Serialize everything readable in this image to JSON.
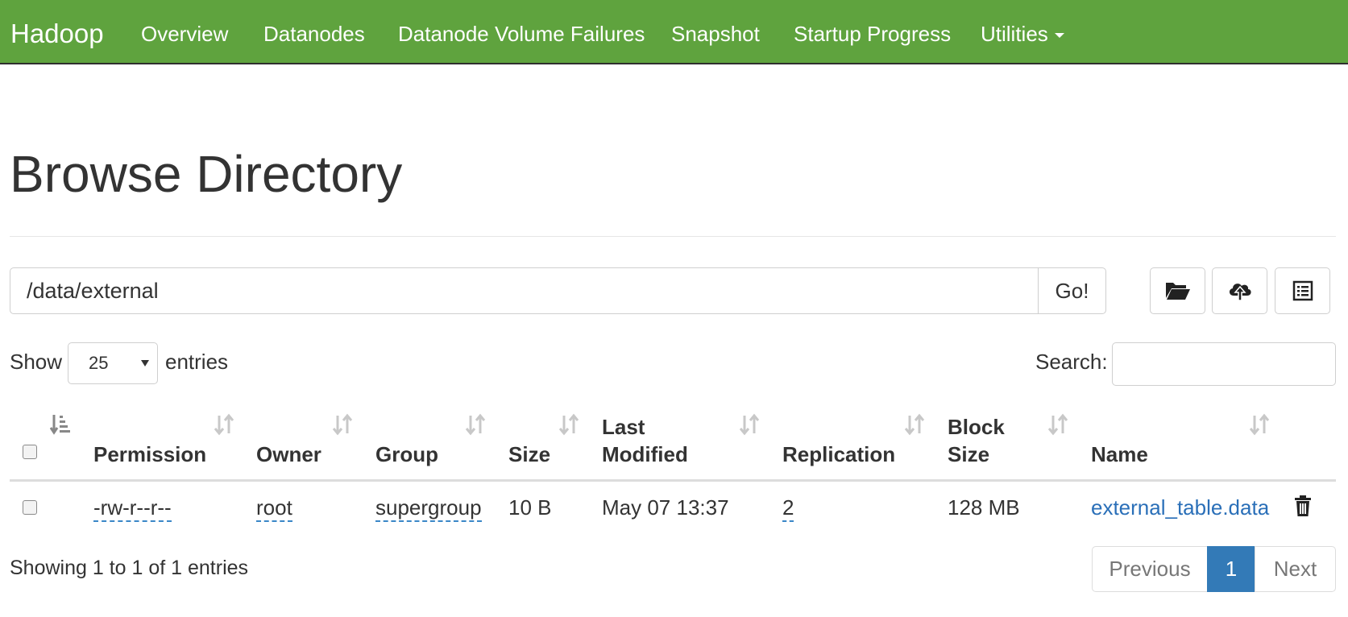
{
  "navbar": {
    "brand": "Hadoop",
    "items": [
      {
        "label": "Overview"
      },
      {
        "label": "Datanodes"
      },
      {
        "label": "Datanode Volume Failures"
      },
      {
        "label": "Snapshot"
      },
      {
        "label": "Startup Progress"
      },
      {
        "label": "Utilities"
      }
    ]
  },
  "page": {
    "title": "Browse Directory"
  },
  "path_bar": {
    "value": "/data/external",
    "go_label": "Go!"
  },
  "toolbar": {
    "buttons": [
      {
        "icon": "folder-open-icon"
      },
      {
        "icon": "cloud-upload-icon"
      },
      {
        "icon": "list-icon"
      }
    ]
  },
  "controls": {
    "show_label": "Show",
    "entries_value": "25",
    "entries_label": "entries",
    "search_label": "Search:",
    "search_value": ""
  },
  "table": {
    "columns": [
      {
        "label": ""
      },
      {
        "label": "Permission"
      },
      {
        "label": "Owner"
      },
      {
        "label": "Group"
      },
      {
        "label": "Size"
      },
      {
        "line1": "Last",
        "line2": "Modified"
      },
      {
        "label": "Replication"
      },
      {
        "line1": "Block",
        "line2": "Size"
      },
      {
        "label": "Name"
      }
    ],
    "rows": [
      {
        "permission": "-rw-r--r--",
        "owner": "root",
        "group": "supergroup",
        "size": "10 B",
        "last_modified": "May 07 13:37",
        "replication": "2",
        "block_size": "128 MB",
        "name": "external_table.data"
      }
    ]
  },
  "footer": {
    "info": "Showing 1 to 1 of 1 entries",
    "pagination": {
      "previous": "Previous",
      "current": "1",
      "next": "Next"
    }
  },
  "colors": {
    "navbar_bg": "#5fa33e",
    "link": "#2a6fb8",
    "active_page": "#337ab7"
  }
}
